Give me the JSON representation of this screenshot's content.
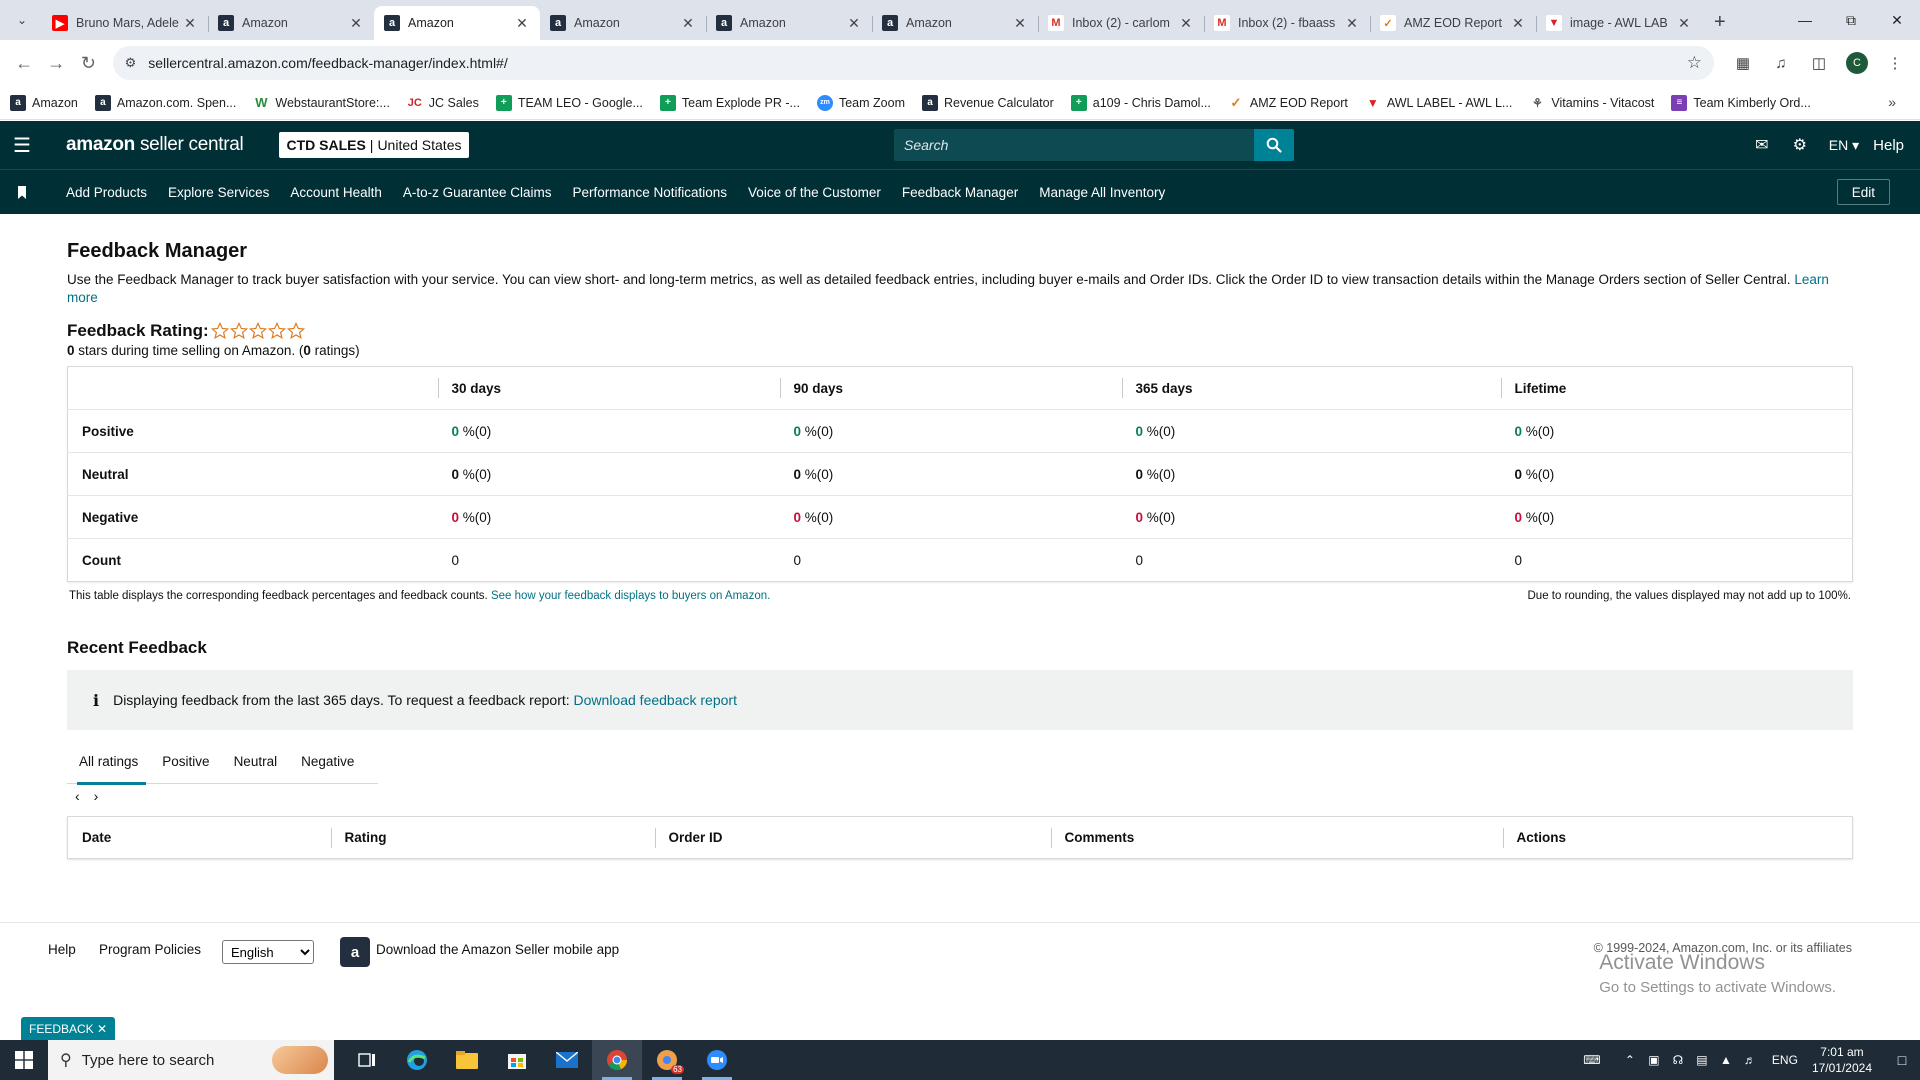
{
  "browser": {
    "tabs": [
      {
        "title": "Bruno Mars, Adele",
        "favicon": "youtube-icon",
        "active": false
      },
      {
        "title": "Amazon",
        "favicon": "amazon-icon",
        "active": false
      },
      {
        "title": "Amazon",
        "favicon": "amazon-icon",
        "active": true
      },
      {
        "title": "Amazon",
        "favicon": "amazon-icon",
        "active": false
      },
      {
        "title": "Amazon",
        "favicon": "amazon-icon",
        "active": false
      },
      {
        "title": "Amazon",
        "favicon": "amazon-icon",
        "active": false
      },
      {
        "title": "Inbox (2) - carlom",
        "favicon": "gmail-icon",
        "active": false
      },
      {
        "title": "Inbox (2) - fbaass",
        "favicon": "gmail-icon",
        "active": false
      },
      {
        "title": "AMZ EOD Report",
        "favicon": "amz-report-icon",
        "active": false
      },
      {
        "title": "image - AWL LAB",
        "favicon": "awl-icon",
        "active": false
      }
    ],
    "url": "sellercentral.amazon.com/feedback-manager/index.html#/",
    "profile_initial": "C",
    "bookmarks": [
      {
        "label": "Amazon",
        "icon": "a"
      },
      {
        "label": "Amazon.com. Spen...",
        "icon": "a"
      },
      {
        "label": "WebstaurantStore:...",
        "icon": "w"
      },
      {
        "label": "JC Sales",
        "icon": "jc"
      },
      {
        "label": "TEAM LEO - Google...",
        "icon": "g"
      },
      {
        "label": "Team Explode PR -...",
        "icon": "g"
      },
      {
        "label": "Team Zoom",
        "icon": "zm"
      },
      {
        "label": "Revenue Calculator",
        "icon": "a"
      },
      {
        "label": "a109 - Chris Damol...",
        "icon": "g"
      },
      {
        "label": "AMZ EOD Report",
        "icon": "amz"
      },
      {
        "label": "AWL LABEL - AWL L...",
        "icon": "awl"
      },
      {
        "label": "Vitamins - Vitacost",
        "icon": "v"
      },
      {
        "label": "Team Kimberly Ord...",
        "icon": "p"
      }
    ]
  },
  "header": {
    "logo_brand": "amazon",
    "logo_product": "seller central",
    "store_name": "CTD SALES",
    "store_sep": "|",
    "store_region": "United States",
    "search_placeholder": "Search",
    "language": "EN",
    "help": "Help"
  },
  "nav": {
    "links": [
      "Add Products",
      "Explore Services",
      "Account Health",
      "A-to-z Guarantee Claims",
      "Performance Notifications",
      "Voice of the Customer",
      "Feedback Manager",
      "Manage All Inventory"
    ],
    "edit": "Edit"
  },
  "page": {
    "title": "Feedback Manager",
    "intro": "Use the Feedback Manager to track buyer satisfaction with your service. You can view short- and long-term metrics, as well as detailed feedback entries, including buyer e-mails and Order IDs. Click the Order ID to view transaction details within the Manage Orders section of Seller Central.",
    "learn_more": "Learn more",
    "rating_label": "Feedback Rating:",
    "stars_count": "0",
    "stars_text": " stars during time selling on Amazon. (",
    "ratings_count": "0",
    "ratings_text": " ratings)",
    "rating_value": 0,
    "rating_max": 5
  },
  "summary_table": {
    "columns": [
      "",
      "30 days",
      "90 days",
      "365 days",
      "Lifetime"
    ],
    "rows": [
      {
        "label": "Positive",
        "kind": "positive",
        "cells": [
          {
            "v": "0",
            "s": " %(0)"
          },
          {
            "v": "0",
            "s": " %(0)"
          },
          {
            "v": "0",
            "s": " %(0)"
          },
          {
            "v": "0",
            "s": " %(0)"
          }
        ]
      },
      {
        "label": "Neutral",
        "kind": "neutral",
        "cells": [
          {
            "v": "0",
            "s": " %(0)"
          },
          {
            "v": "0",
            "s": " %(0)"
          },
          {
            "v": "0",
            "s": " %(0)"
          },
          {
            "v": "0",
            "s": " %(0)"
          }
        ]
      },
      {
        "label": "Negative",
        "kind": "negative",
        "cells": [
          {
            "v": "0",
            "s": " %(0)"
          },
          {
            "v": "0",
            "s": " %(0)"
          },
          {
            "v": "0",
            "s": " %(0)"
          },
          {
            "v": "0",
            "s": " %(0)"
          }
        ]
      },
      {
        "label": "Count",
        "kind": "count",
        "cells": [
          {
            "v": "0",
            "s": ""
          },
          {
            "v": "0",
            "s": ""
          },
          {
            "v": "0",
            "s": ""
          },
          {
            "v": "0",
            "s": ""
          }
        ]
      }
    ],
    "footnote": "This table displays the corresponding feedback percentages and feedback counts.",
    "footnote_link": "See how your feedback displays to buyers on Amazon.",
    "rounding_note": "Due to rounding, the values displayed may not add up to 100%."
  },
  "recent": {
    "title": "Recent Feedback",
    "info_text": "Displaying feedback from the last 365 days. To request a feedback report:",
    "info_link": "Download feedback report",
    "tabs": [
      "All ratings",
      "Positive",
      "Neutral",
      "Negative"
    ],
    "active_tab": "All ratings",
    "columns": [
      "Date",
      "Rating",
      "Order ID",
      "Comments",
      "Actions"
    ]
  },
  "footer": {
    "help": "Help",
    "policies": "Program Policies",
    "language_selected": "English",
    "app_text": "Download the Amazon Seller mobile app",
    "copyright": "© 1999-2024, Amazon.com, Inc. or its affiliates",
    "activate_title": "Activate Windows",
    "activate_sub": "Go to Settings to activate Windows.",
    "feedback_button": "FEEDBACK"
  },
  "taskbar": {
    "search_placeholder": "Type here to search",
    "language": "ENG",
    "time": "7:01 am",
    "date": "17/01/2024",
    "badge_count": "63"
  },
  "colors": {
    "header_bg": "#002f36",
    "accent": "#008296",
    "link": "#007185",
    "positive": "#067d62",
    "negative": "#cc0c39"
  }
}
